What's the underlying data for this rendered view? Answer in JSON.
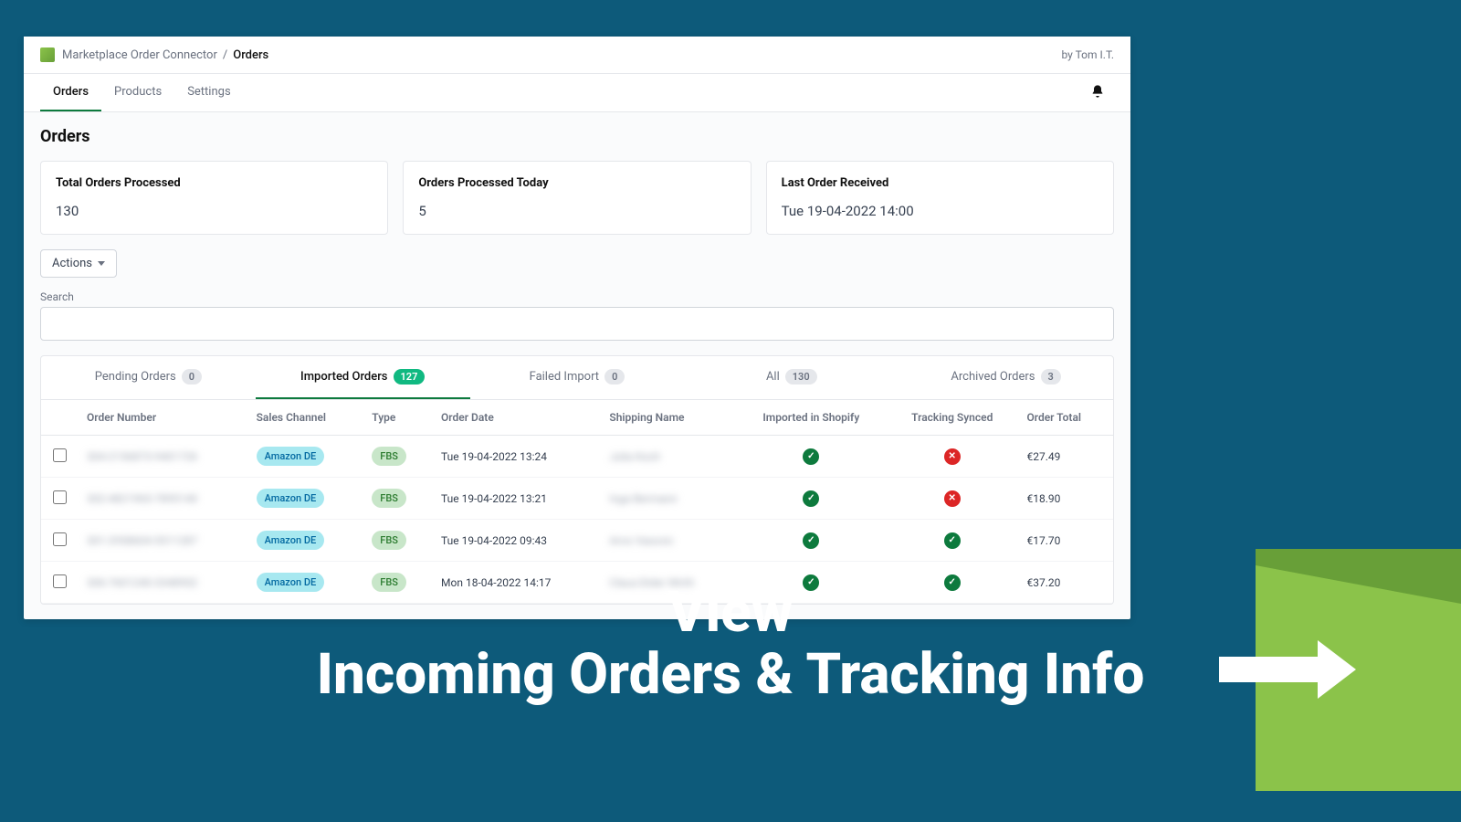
{
  "header": {
    "crumb1": "Marketplace Order Connector",
    "crumb2": "Orders",
    "byline": "by Tom I.T."
  },
  "nav": {
    "orders": "Orders",
    "products": "Products",
    "settings": "Settings"
  },
  "page_title": "Orders",
  "stats": {
    "total": {
      "label": "Total Orders Processed",
      "value": "130"
    },
    "today": {
      "label": "Orders Processed Today",
      "value": "5"
    },
    "last": {
      "label": "Last Order Received",
      "value": "Tue 19-04-2022 14:00"
    }
  },
  "actions_label": "Actions",
  "search_label": "Search",
  "table_tabs": {
    "pending": {
      "label": "Pending Orders",
      "count": "0"
    },
    "imported": {
      "label": "Imported Orders",
      "count": "127"
    },
    "failed": {
      "label": "Failed Import",
      "count": "0"
    },
    "all": {
      "label": "All",
      "count": "130"
    },
    "archived": {
      "label": "Archived Orders",
      "count": "3"
    }
  },
  "columns": {
    "order_number": "Order Number",
    "sales_channel": "Sales Channel",
    "type": "Type",
    "order_date": "Order Date",
    "shipping_name": "Shipping Name",
    "imported": "Imported in Shopify",
    "tracking": "Tracking Synced",
    "total": "Order Total"
  },
  "rows": [
    {
      "order_number": "304-2156873-9401726",
      "sales_channel": "Amazon DE",
      "type": "FBS",
      "order_date": "Tue 19-04-2022 13:24",
      "shipping_name": "Julia Koch",
      "imported": true,
      "tracking": false,
      "total": "€27.49"
    },
    {
      "order_number": "302-4821965-7895140",
      "sales_channel": "Amazon DE",
      "type": "FBS",
      "order_date": "Tue 19-04-2022 13:21",
      "shipping_name": "Inga Bermann",
      "imported": true,
      "tracking": false,
      "total": "€18.90"
    },
    {
      "order_number": "301-2958604-5511287",
      "sales_channel": "Amazon DE",
      "type": "FBS",
      "order_date": "Tue 19-04-2022 09:43",
      "shipping_name": "Arno Vasovic",
      "imported": true,
      "tracking": true,
      "total": "€17.70"
    },
    {
      "order_number": "306-7601240-3348902",
      "sales_channel": "Amazon DE",
      "type": "FBS",
      "order_date": "Mon 18-04-2022 14:17",
      "shipping_name": "Claus-Dider Wirth",
      "imported": true,
      "tracking": true,
      "total": "€37.20"
    }
  ],
  "promo": {
    "line1": "View",
    "line2": "Incoming Orders & Tracking Info"
  }
}
